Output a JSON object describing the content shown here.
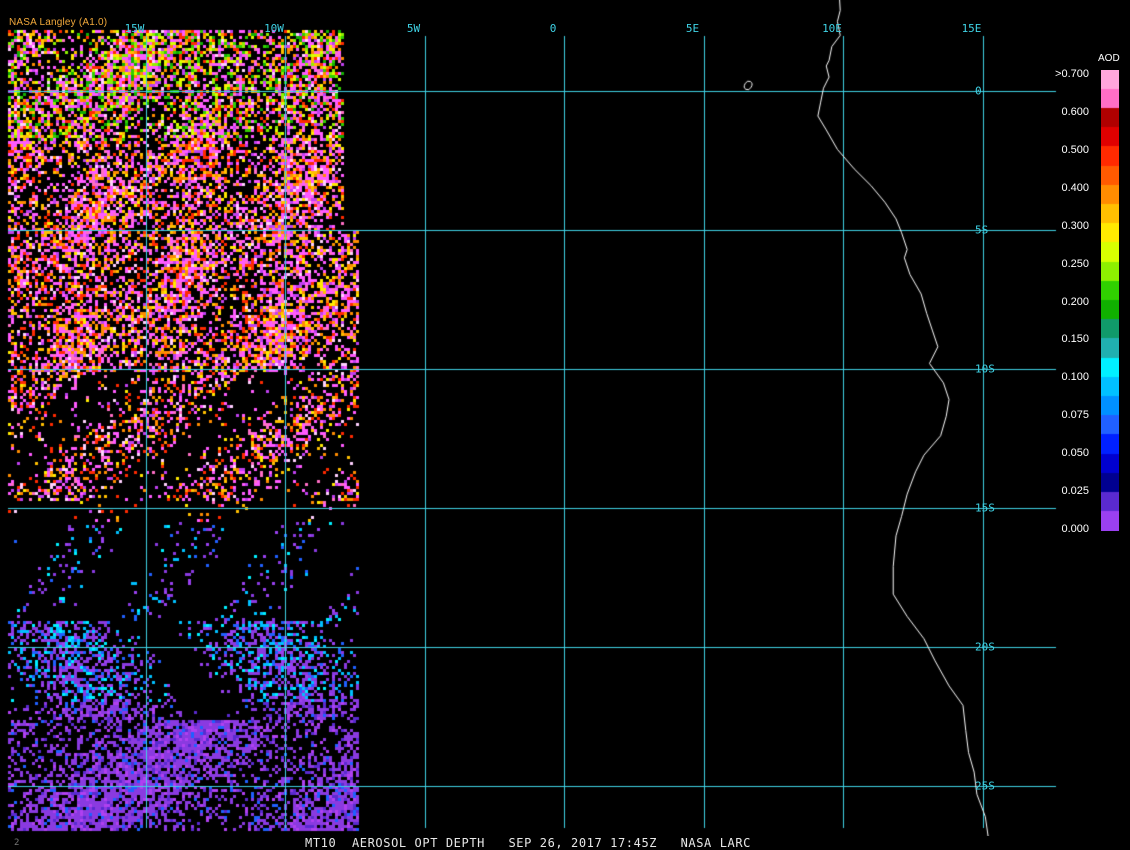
{
  "credit": "NASA Langley (A1.0)",
  "footer": "MT10  AEROSOL OPT DEPTH   SEP 26, 2017 17:45Z   NASA LARC",
  "corner_mark": "2",
  "grid": {
    "longitudes": [
      {
        "label": "15W",
        "deg": -15
      },
      {
        "label": "10W",
        "deg": -10
      },
      {
        "label": "5W",
        "deg": -5
      },
      {
        "label": "0",
        "deg": 0
      },
      {
        "label": "5E",
        "deg": 5
      },
      {
        "label": "10E",
        "deg": 10
      },
      {
        "label": "15E",
        "deg": 15
      }
    ],
    "latitudes": [
      {
        "label": "0",
        "deg": 0
      },
      {
        "label": "5S",
        "deg": -5
      },
      {
        "label": "10S",
        "deg": -10
      },
      {
        "label": "15S",
        "deg": -15
      },
      {
        "label": "20S",
        "deg": -20
      },
      {
        "label": "25S",
        "deg": -25
      }
    ],
    "line_color": "#3fd3e6"
  },
  "legend": {
    "title": "AOD",
    "labels": [
      ">0.700",
      "0.600",
      "0.500",
      "0.400",
      "0.300",
      "0.250",
      "0.200",
      "0.150",
      "0.100",
      "0.075",
      "0.050",
      "0.025",
      "0.000"
    ],
    "colors": [
      "#ffa6dc",
      "#ff6ec6",
      "#b00000",
      "#e00000",
      "#ff2a00",
      "#ff5a00",
      "#ff8c00",
      "#ffbf00",
      "#ffea00",
      "#d8ff00",
      "#8ef000",
      "#30d000",
      "#10b000",
      "#109a6a",
      "#20b0b0",
      "#00f0ff",
      "#00c0ff",
      "#0090ff",
      "#2060ff",
      "#0020ff",
      "#0000d0",
      "#000090",
      "#5a2ad0",
      "#9a40f0"
    ]
  },
  "coastline_color": "#ffffff"
}
